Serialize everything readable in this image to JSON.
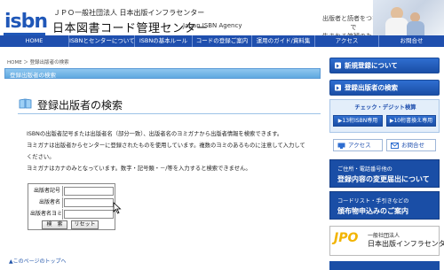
{
  "header": {
    "logo_text": "isbn",
    "org_small": "ＪＰＯ一般社団法人 日本出版インフラセンター",
    "org_main": "日本図書コード管理センター",
    "org_en": "Japan ISBN Agency",
    "tagline_line1": "出版者と読者をつないで",
    "tagline_line2": "生まれる笑顔のために"
  },
  "nav": {
    "items": [
      {
        "label": "HOME"
      },
      {
        "label": "ISBNとセンターについて"
      },
      {
        "label": "ISBNの基本ルール"
      },
      {
        "label": "コードの登録ご案内"
      },
      {
        "label": "運用のガイド/資料集"
      },
      {
        "label": "アクセス"
      },
      {
        "label": "お問合せ"
      }
    ]
  },
  "breadcrumb": "HOME ＞ 登録出版者の検索",
  "title_band": "登録出版者の検索",
  "heading": "登録出版者の検索",
  "paragraphs": {
    "p1": "ISBNの出版者記号または出版者名（部分一致）、出版者名のヨミガナから出版者情報を検索できます。",
    "p2": "ヨミガナは出版者からセンターに登録されたものを使用しています。複数のヨミのあるものに注意して入力して",
    "p3": "ください。",
    "p4": "ヨミガナはカナのみとなっています。数字・記号類・－/等を入力すると検索できません。"
  },
  "form": {
    "label_code": "出版者記号",
    "label_name": "出版者名",
    "label_yomi": "出版者名ヨミ",
    "value_code": "",
    "value_name": "",
    "value_yomi": "",
    "search_button": "検　索",
    "reset_button": "リセット"
  },
  "to_top": "▲このページのトップへ",
  "sidebar": {
    "new_registration": "新規登録について",
    "publisher_search": "登録出版者の検索",
    "check_title": "チェック・デジット検算",
    "check13": "▶13桁ISBN専用",
    "check10": "▶10桁書換え専用",
    "access": "アクセス",
    "contact": "お問合せ",
    "change_small": "ご住所・電話番号他の",
    "change_big": "登録内容の変更届出について",
    "apply_small": "コードリスト・手引きなどの",
    "apply_big": "頒布物申込みのご案内",
    "jpo_logo": "JPO",
    "jpo_small": "一般社団法人",
    "jpo_main": "日本出版インフラセンター"
  }
}
